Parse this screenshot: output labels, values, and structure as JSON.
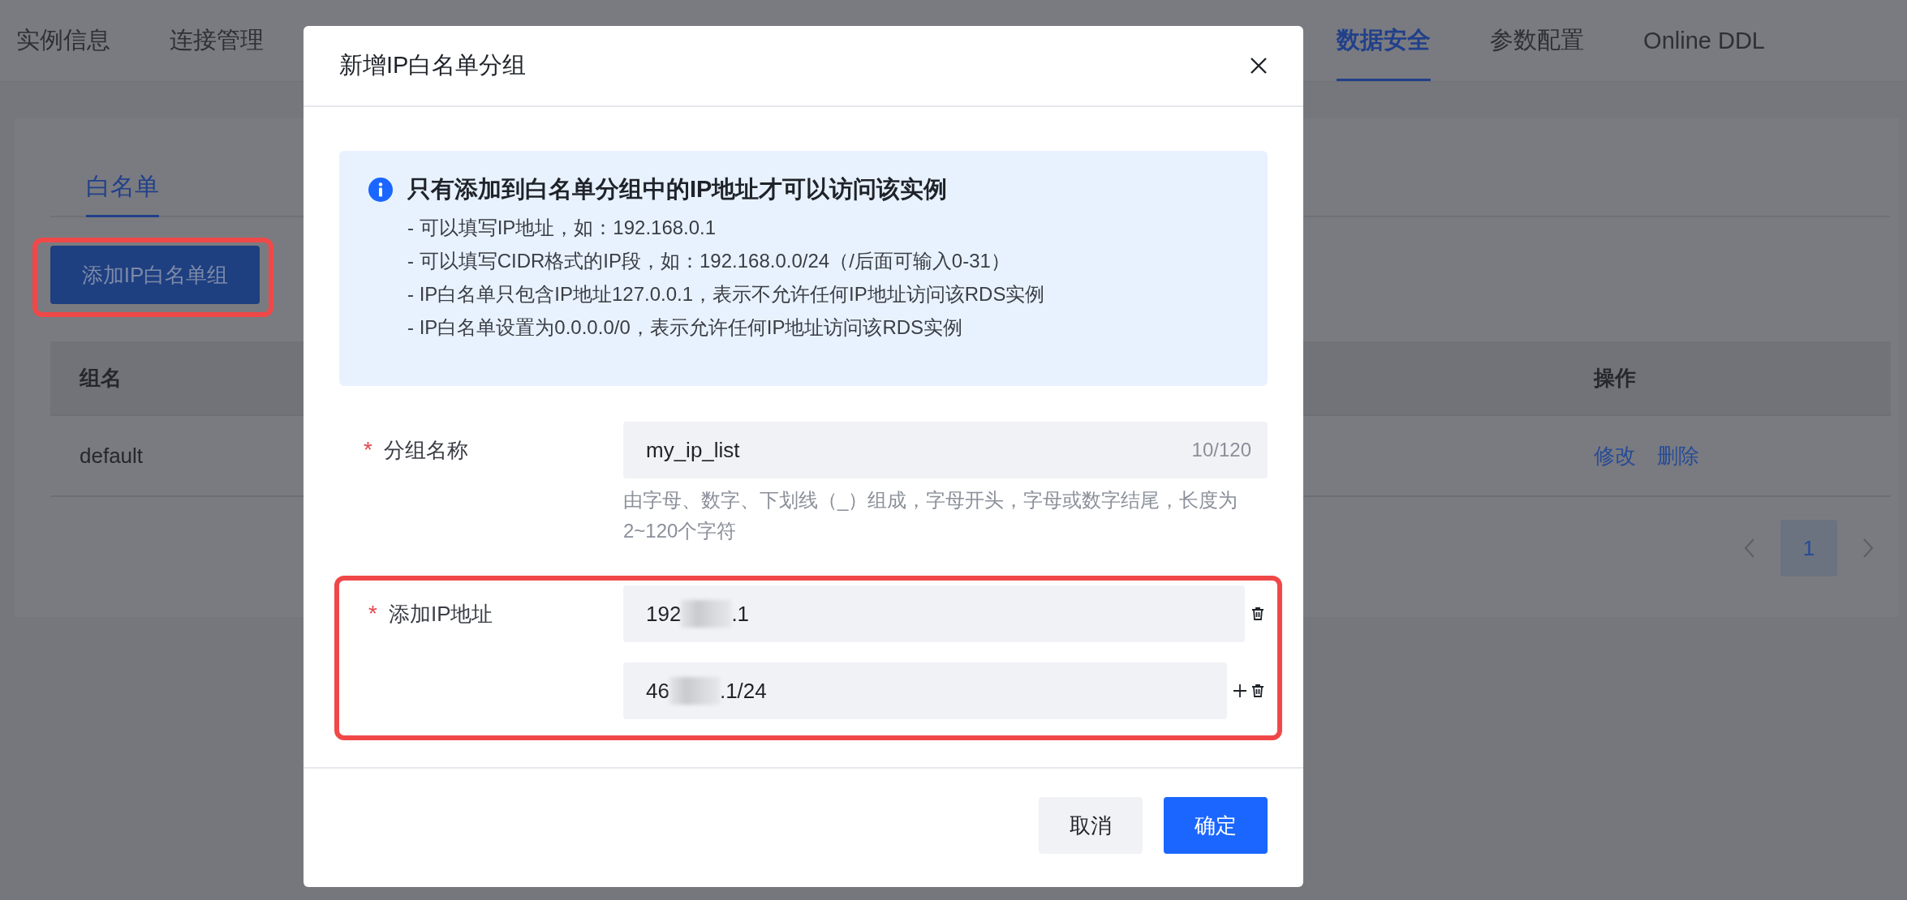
{
  "nav_tabs_left": [
    {
      "label": "实例信息",
      "selected": false
    },
    {
      "label": "连接管理",
      "selected": false
    }
  ],
  "nav_tabs_right": [
    {
      "label": "数据安全",
      "selected": true
    },
    {
      "label": "参数配置",
      "selected": false
    },
    {
      "label": "Online DDL",
      "selected": false
    }
  ],
  "page": {
    "sub_tabs": [
      {
        "label": "白名单",
        "selected": true
      }
    ],
    "add_button": {
      "label": "添加IP白名单组",
      "highlighted": true
    },
    "table": {
      "columns": [
        "组名",
        "操作"
      ],
      "rows": [
        {
          "name": "default",
          "actions": [
            "修改",
            "删除"
          ]
        }
      ]
    },
    "pagination": {
      "pages": [
        {
          "label": "1",
          "selected": true
        }
      ]
    }
  },
  "dialog": {
    "title": "新增IP白名单分组",
    "notice": {
      "title": "只有添加到白名单分组中的IP地址才可以访问该实例",
      "items": [
        "- 可以填写IP地址，如：192.168.0.1",
        "- 可以填写CIDR格式的IP段，如：192.168.0.0/24（/后面可输入0-31）",
        "- IP白名单只包含IP地址127.0.0.1，表示不允许任何IP地址访问该RDS实例",
        "- IP白名单设置为0.0.0.0/0，表示允许任何IP地址访问该RDS实例"
      ]
    },
    "fields": [
      {
        "kind": "text",
        "required_mark": "*",
        "label": "分组名称",
        "value": "my_ip_list",
        "counter": "10/120",
        "hint": "由字母、数字、下划线（_）组成，字母开头，字母或数字结尾，长度为2~120个字符"
      },
      {
        "kind": "ip_list",
        "required_mark": "*",
        "label": "添加IP地址",
        "highlighted": true,
        "entries": [
          {
            "prefix": "192",
            "suffix": ".1",
            "addable": false
          },
          {
            "prefix": "46",
            "suffix": ".1/24",
            "addable": true
          }
        ]
      }
    ],
    "buttons": [
      {
        "label": "取消",
        "kind": "secondary"
      },
      {
        "label": "确定",
        "kind": "primary"
      }
    ]
  }
}
